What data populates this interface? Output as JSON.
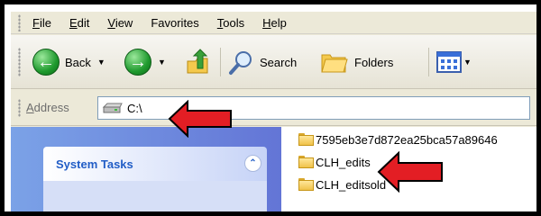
{
  "menu": {
    "items": [
      {
        "label_first": "F",
        "label_rest": "ile"
      },
      {
        "label_first": "E",
        "label_rest": "dit"
      },
      {
        "label_first": "V",
        "label_rest": "iew"
      },
      {
        "label_first": "Fa",
        "label_rest": "vorites"
      },
      {
        "label_first": "T",
        "label_rest": "ools"
      },
      {
        "label_first": "H",
        "label_rest": "elp"
      }
    ]
  },
  "toolbar": {
    "back_label": "Back",
    "search_label": "Search",
    "folders_label": "Folders"
  },
  "address": {
    "label_first": "A",
    "label_rest": "ddress",
    "value": "C:\\"
  },
  "tasks": {
    "title": "System Tasks"
  },
  "files": [
    "7595eb3e7d872ea25bca57a89646",
    "CLH_edits",
    "CLH_editsold"
  ],
  "colors": {
    "annotation": "#e31e24",
    "panel_blue": "#6f8ce0",
    "xp_chrome": "#ECE9D8"
  }
}
